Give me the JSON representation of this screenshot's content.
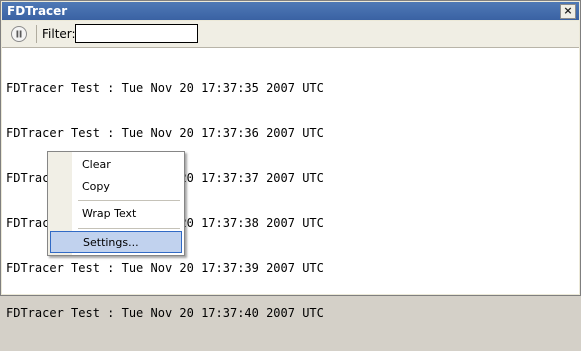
{
  "window": {
    "title": "FDTracer",
    "close_label": "×"
  },
  "toolbar": {
    "filter_label": "Filter:",
    "filter_value": "",
    "filter_placeholder": ""
  },
  "log": {
    "lines": [
      "FDTracer Test : Tue Nov 20 17:37:35 2007 UTC",
      "FDTracer Test : Tue Nov 20 17:37:36 2007 UTC",
      "FDTracer Test : Tue Nov 20 17:37:37 2007 UTC",
      "FDTracer Test : Tue Nov 20 17:37:38 2007 UTC",
      "FDTracer Test : Tue Nov 20 17:37:39 2007 UTC",
      "FDTracer Test : Tue Nov 20 17:37:40 2007 UTC"
    ]
  },
  "context_menu": {
    "items": [
      {
        "label": "Clear"
      },
      {
        "label": "Copy"
      },
      {
        "label": "Wrap Text"
      },
      {
        "label": "Settings..."
      }
    ]
  },
  "icons": {
    "pause": "pause-icon",
    "close": "close-icon"
  },
  "colors": {
    "titlebar": "#3f69aa",
    "menu_highlight": "#c1d2ee",
    "menu_highlight_border": "#316ac5"
  }
}
